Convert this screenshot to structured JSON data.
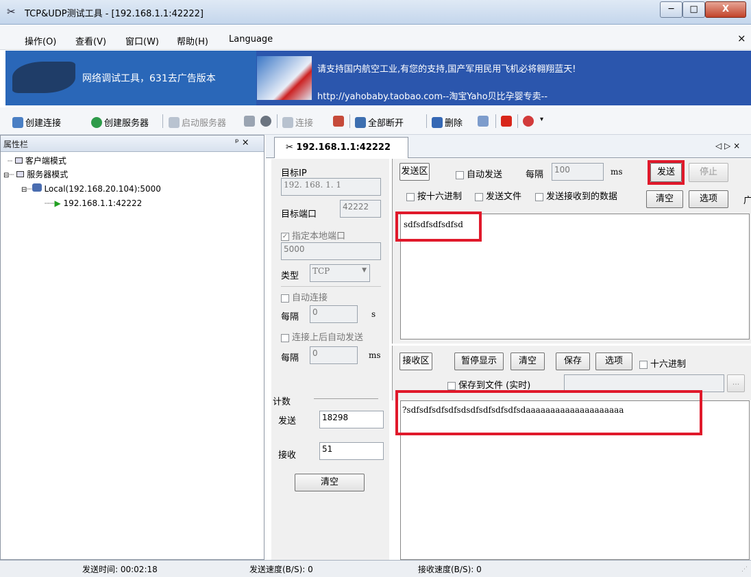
{
  "window": {
    "title": "TCP&UDP测试工具 - [192.168.1.1:42222]",
    "min": "─",
    "max": "□",
    "close": "X"
  },
  "menu": {
    "items": [
      "操作(O)",
      "查看(V)",
      "窗口(W)",
      "帮助(H)",
      "Language"
    ],
    "close": "×"
  },
  "banner": {
    "left_text": "网络调试工具，631去广告版本",
    "right_line1": "请支持国内航空工业,有您的支持,国产军用民用飞机必将翱翔蓝天!",
    "right_line2": "http://yahobaby.taobao.com--淘宝Yaho贝比孕婴专卖--"
  },
  "toolbar": {
    "create_conn": "创建连接",
    "create_server": "创建服务器",
    "start_server": "启动服务器",
    "connect": "连接",
    "disconnect_all": "全部断开",
    "delete": "删除"
  },
  "left_panel": {
    "title": "属性栏",
    "controls": "ᵖ ×",
    "tree": {
      "client_mode": "客户端模式",
      "server_mode": "服务器模式",
      "local": "Local(192.168.20.104):5000",
      "conn": "192.168.1.1:42222"
    }
  },
  "right_panel": {
    "tab": "192.168.1.1:42222",
    "controls": "◁ ▷ ×"
  },
  "config": {
    "target_ip_label": "目标IP",
    "target_ip": "192. 168. 1. 1",
    "target_port_label": "目标端口",
    "target_port": "42222",
    "local_port_label": "指定本地端口",
    "local_port": "5000",
    "type_label": "类型",
    "type_value": "TCP",
    "auto_connect": "自动连接",
    "interval1_label": "每隔",
    "interval1_value": "0",
    "interval1_unit": "s",
    "auto_send_after": "连接上后自动发送",
    "interval2_label": "每隔",
    "interval2_value": "0",
    "interval2_unit": "ms",
    "count_label": "计数",
    "send_label": "发送",
    "send_count": "18298",
    "recv_label": "接收",
    "recv_count": "51",
    "clear": "清空"
  },
  "send": {
    "zone_label": "发送区",
    "auto_send": "自动发送",
    "interval_label": "每隔",
    "interval_value": "100",
    "interval_unit": "ms",
    "send_btn": "发送",
    "stop_btn": "停止",
    "hex": "按十六进制",
    "send_file": "发送文件",
    "send_received": "发送接收到的数据",
    "clear": "清空",
    "options": "选项",
    "extra": "广",
    "content": "sdfsdfsdfsdfsd"
  },
  "recv": {
    "zone_label": "接收区",
    "pause": "暂停显示",
    "clear": "清空",
    "save": "保存",
    "options": "选项",
    "hex": "十六进制",
    "save_file": "保存到文件 (实时)",
    "browse": "...",
    "content": "?sdfsdfsdfsdfsdsdfsdfsdfsdfsdaaaaaaaaaaaaaaaaaaaa"
  },
  "status": {
    "send_time": "发送时间: 00:02:18",
    "send_speed": "发送速度(B/S): 0",
    "recv_speed": "接收速度(B/S): 0"
  },
  "colors": {
    "banner": "#2b56ad",
    "highlight": "#e0192b"
  }
}
